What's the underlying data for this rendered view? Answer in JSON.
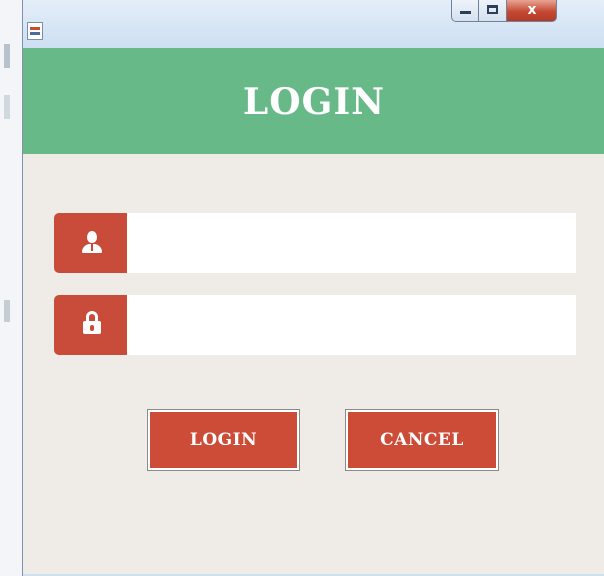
{
  "window": {
    "app_icon": "java-app-icon",
    "controls": {
      "minimize_icon": "minimize-icon",
      "maximize_icon": "maximize-icon",
      "close_icon": "close-icon",
      "close_glyph": "x"
    }
  },
  "header": {
    "title": "LOGIN"
  },
  "form": {
    "username": {
      "icon": "user-icon",
      "value": "",
      "placeholder": ""
    },
    "password": {
      "icon": "lock-icon",
      "value": "",
      "placeholder": ""
    }
  },
  "actions": {
    "login_label": "LOGIN",
    "cancel_label": "CANCEL"
  },
  "colors": {
    "header": "#67b988",
    "accent": "#c94b39",
    "background": "#efece8",
    "field": "#ffffff",
    "text_on_accent": "#ffffff"
  }
}
